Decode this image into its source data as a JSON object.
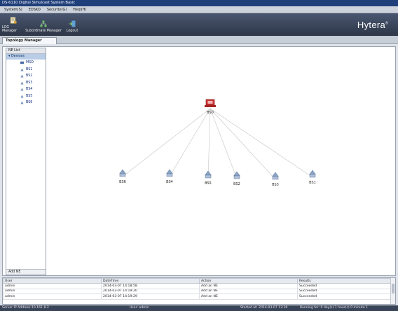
{
  "window": {
    "title": "DS-6110 Digital Simulcast System  Basic"
  },
  "menu": {
    "items": [
      "System(S)",
      "EDSKO",
      "Security(G)",
      "Help(H)"
    ]
  },
  "toolbar": {
    "items": [
      {
        "label": "LOG Manager",
        "icon": "log-manager-icon"
      },
      {
        "label": "Subordinate Manager",
        "icon": "subordinate-manager-icon"
      },
      {
        "label": "Logout",
        "icon": "logout-icon"
      }
    ],
    "logo": "Hytera"
  },
  "tabs": [
    {
      "label": "Topology Manager"
    }
  ],
  "tree": {
    "header": "NE List",
    "root": "Devices",
    "items": [
      "MSO",
      "BS1",
      "BS2",
      "BS3",
      "BS4",
      "BS5",
      "BS6"
    ],
    "footer": "Add NE"
  },
  "topology": {
    "center": {
      "label": "BS0",
      "icon": "switch-icon",
      "color": "#cc3333"
    },
    "nodes": [
      {
        "label": "BS6",
        "icon": "base-station-icon"
      },
      {
        "label": "BS4",
        "icon": "base-station-icon"
      },
      {
        "label": "BS5",
        "icon": "base-station-icon"
      },
      {
        "label": "BS2",
        "icon": "base-station-icon"
      },
      {
        "label": "BS3",
        "icon": "base-station-icon"
      },
      {
        "label": "BS1",
        "icon": "base-station-icon"
      }
    ]
  },
  "log": {
    "columns": [
      "User",
      "DateTime",
      "Action",
      "Results"
    ],
    "rows": [
      [
        "admin",
        "2014-03-07 14:18:58",
        "Add an NE",
        "Succeeded"
      ],
      [
        "admin",
        "2014-03-07 14:19:20",
        "Add an NE",
        "Succeeded"
      ],
      [
        "admin",
        "2014-03-07 14:19:29",
        "Add an NE",
        "Succeeded"
      ]
    ]
  },
  "status": {
    "server": "Server IP Address:10.161.8.2",
    "user": "User: admin",
    "started": "Started at: 2014-03-07 13:30",
    "running": "Running for: 0 day(s) 1 hour(s) 0 minute 1"
  }
}
